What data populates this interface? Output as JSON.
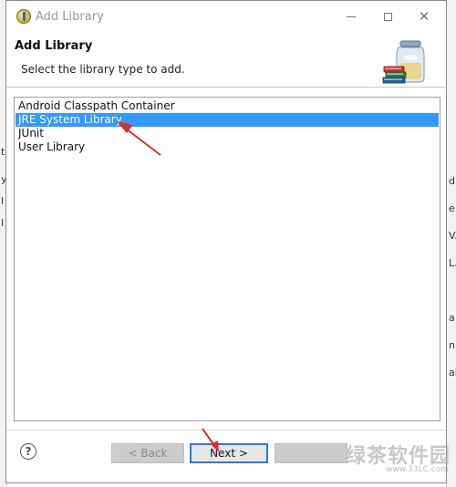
{
  "window": {
    "title": "Add Library",
    "minimize_label": "",
    "maximize_label": "",
    "close_label": "✕"
  },
  "header": {
    "title": "Add Library",
    "description": "Select the library type to add."
  },
  "library_types": [
    {
      "label": "Android Classpath Container",
      "selected": false
    },
    {
      "label": "JRE System Library",
      "selected": true
    },
    {
      "label": "JUnit",
      "selected": false
    },
    {
      "label": "User Library",
      "selected": false
    }
  ],
  "footer": {
    "help_label": "?",
    "back_label": "< Back",
    "next_label": "Next >",
    "finish_label": ""
  },
  "background": {
    "left_marks": [
      "t",
      "y",
      "l",
      "I"
    ],
    "right_marks": [
      "d",
      "e",
      "V.",
      "L.",
      "",
      "a",
      "n",
      "al",
      ""
    ]
  },
  "watermark": {
    "text": "绿茶软件园",
    "url": "www.33LC.com"
  },
  "colors": {
    "selection": "#3399ff",
    "annotation_arrow": "#e0302a",
    "next_border": "#2a7bd6"
  }
}
